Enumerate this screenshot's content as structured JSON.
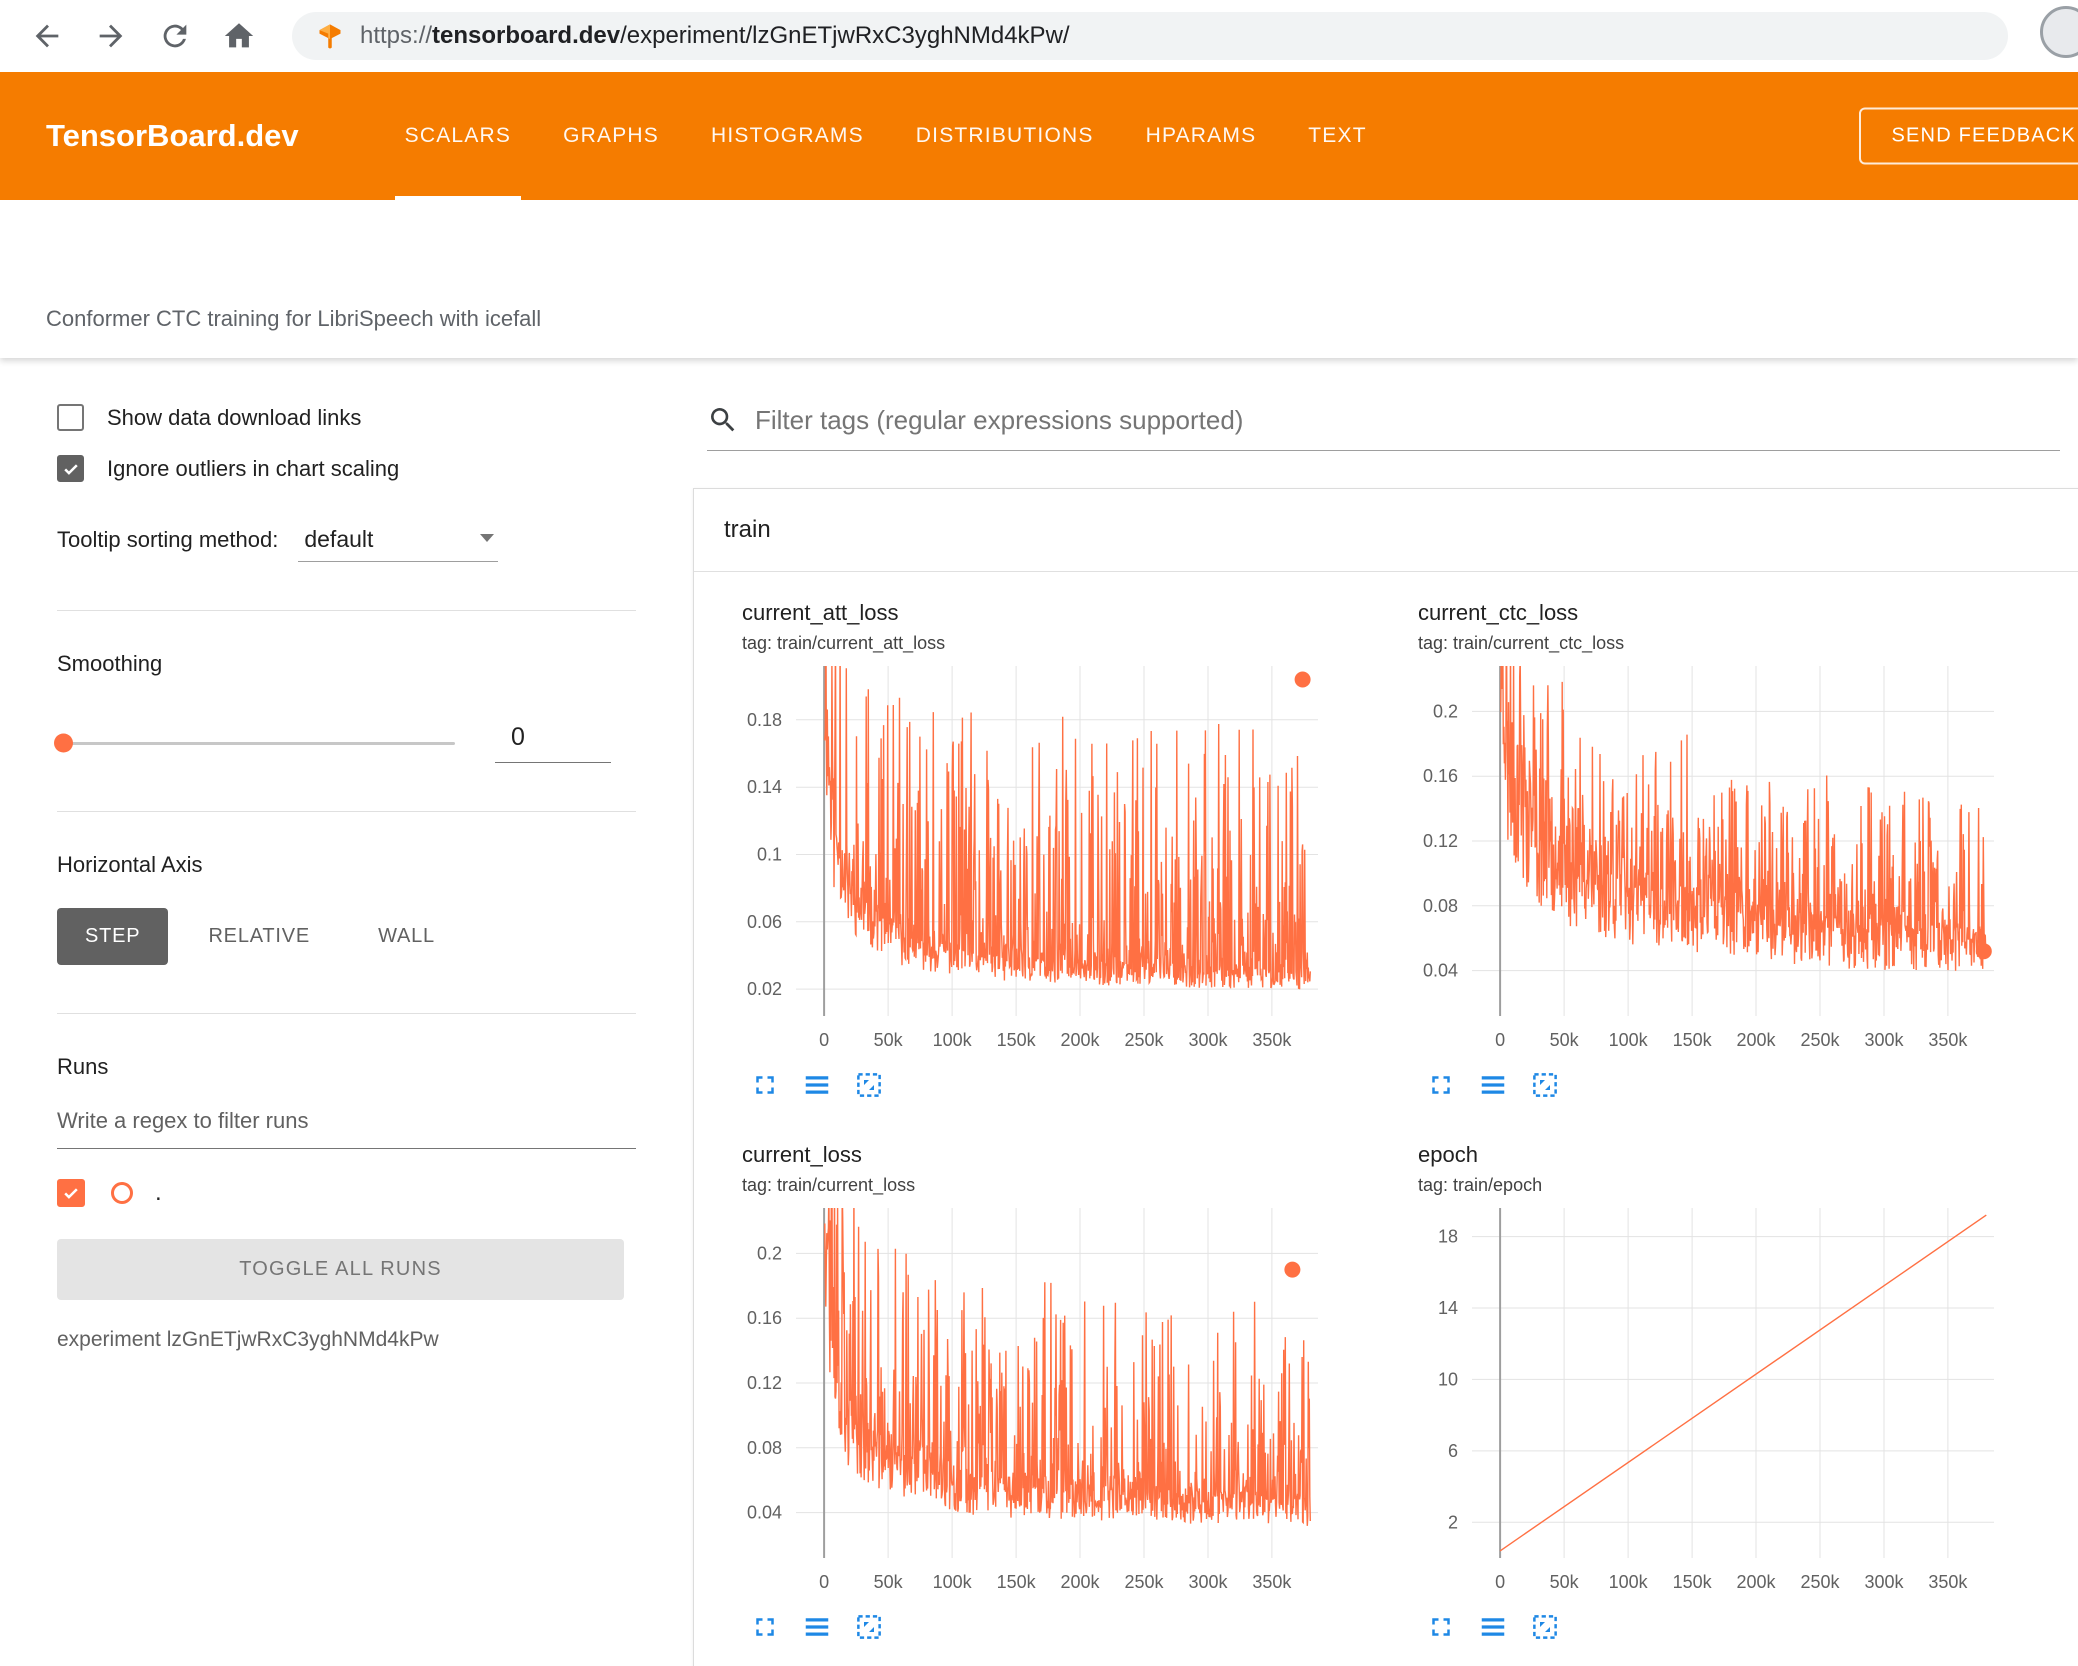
{
  "colors": {
    "header": "#f57c00",
    "series": "#ff7043",
    "tool-blue": "#1e88e5"
  },
  "browser": {
    "url_scheme": "https://",
    "url_domain": "tensorboard.dev",
    "url_path": "/experiment/lzGnETjwRxC3yghNMd4kPw/"
  },
  "header": {
    "brand": "TensorBoard.dev",
    "tabs": [
      {
        "label": "SCALARS",
        "active": true
      },
      {
        "label": "GRAPHS",
        "active": false
      },
      {
        "label": "HISTOGRAMS",
        "active": false
      },
      {
        "label": "DISTRIBUTIONS",
        "active": false
      },
      {
        "label": "HPARAMS",
        "active": false
      },
      {
        "label": "TEXT",
        "active": false
      }
    ],
    "feedback_button": "SEND FEEDBACK"
  },
  "experiment_bar": {
    "title": "Conformer CTC training for LibriSpeech with icefall"
  },
  "sidebar": {
    "show_download": {
      "label": "Show data download links",
      "checked": false
    },
    "ignore_outliers": {
      "label": "Ignore outliers in chart scaling",
      "checked": true
    },
    "tooltip_sort": {
      "label": "Tooltip sorting method:",
      "value": "default"
    },
    "smoothing": {
      "label": "Smoothing",
      "value": "0"
    },
    "horizontal_axis": {
      "label": "Horizontal Axis",
      "options": [
        {
          "label": "STEP",
          "active": true
        },
        {
          "label": "RELATIVE",
          "active": false
        },
        {
          "label": "WALL",
          "active": false
        }
      ]
    },
    "runs": {
      "label": "Runs",
      "filter_placeholder": "Write a regex to filter runs",
      "run_checked": true,
      "run_label": ".",
      "toggle_button": "TOGGLE ALL RUNS",
      "experiment_caption": "experiment lzGnETjwRxC3yghNMd4kPw"
    }
  },
  "main": {
    "filter_placeholder": "Filter tags (regular expressions supported)",
    "card_title": "train"
  },
  "icons": {
    "back-icon": "arrow-left",
    "forward-icon": "arrow-right",
    "reload-icon": "circular-arrow",
    "home-icon": "house",
    "site-favicon": "tensorboard-logo",
    "avatar": "profile-circle",
    "search-icon": "magnifier",
    "dropdown-caret-icon": "triangle-down",
    "expand-icon": "fullscreen-corners",
    "lines-icon": "three-horizontal-lines",
    "fit-domain-icon": "dashed-square-arrows"
  },
  "chart_data": [
    {
      "type": "line",
      "title": "current_att_loss",
      "tag": "tag: train/current_att_loss",
      "xlabel": "step",
      "x_range": [
        -22000,
        386000
      ],
      "y_range": [
        0.004,
        0.212
      ],
      "y_ticks": [
        0.02,
        0.06,
        0.1,
        0.14,
        0.18
      ],
      "x_tick_values": [
        0,
        50000,
        100000,
        150000,
        200000,
        250000,
        300000,
        350000
      ],
      "x_tick_labels": [
        "0",
        "50k",
        "100k",
        "150k",
        "200k",
        "250k",
        "300k",
        "350k"
      ],
      "grid": true,
      "end_dot": [
        374000,
        0.204
      ],
      "noise_spec": {
        "seed": 11,
        "n": 950,
        "x_start": 500,
        "x_end": 380000,
        "base_keys": [
          [
            0,
            0.2
          ],
          [
            6000,
            0.11
          ],
          [
            20000,
            0.07
          ],
          [
            60000,
            0.045
          ],
          [
            120000,
            0.034
          ],
          [
            240000,
            0.028
          ],
          [
            380000,
            0.026
          ]
        ],
        "spike_keys": [
          [
            0,
            0.17
          ],
          [
            30000,
            0.15
          ],
          [
            380000,
            0.145
          ]
        ],
        "spike_pow": 5,
        "wiggle": 0.5
      }
    },
    {
      "type": "line",
      "title": "current_ctc_loss",
      "tag": "tag: train/current_ctc_loss",
      "xlabel": "step",
      "x_range": [
        -22000,
        386000
      ],
      "y_range": [
        0.012,
        0.228
      ],
      "y_ticks": [
        0.04,
        0.08,
        0.12,
        0.16,
        0.2
      ],
      "x_tick_values": [
        0,
        50000,
        100000,
        150000,
        200000,
        250000,
        300000,
        350000
      ],
      "x_tick_labels": [
        "0",
        "50k",
        "100k",
        "150k",
        "200k",
        "250k",
        "300k",
        "350k"
      ],
      "grid": true,
      "end_dot": [
        378000,
        0.052
      ],
      "noise_spec": {
        "seed": 23,
        "n": 950,
        "x_start": 500,
        "x_end": 380000,
        "base_keys": [
          [
            0,
            0.24
          ],
          [
            6000,
            0.16
          ],
          [
            20000,
            0.12
          ],
          [
            60000,
            0.09
          ],
          [
            120000,
            0.074
          ],
          [
            240000,
            0.06
          ],
          [
            380000,
            0.052
          ]
        ],
        "spike_keys": [
          [
            0,
            0.11
          ],
          [
            30000,
            0.1
          ],
          [
            380000,
            0.09
          ]
        ],
        "spike_pow": 4,
        "wiggle": 0.6
      }
    },
    {
      "type": "line",
      "title": "current_loss",
      "tag": "tag: train/current_loss",
      "xlabel": "step",
      "x_range": [
        -22000,
        386000
      ],
      "y_range": [
        0.012,
        0.228
      ],
      "y_ticks": [
        0.04,
        0.08,
        0.12,
        0.16,
        0.2
      ],
      "x_tick_values": [
        0,
        50000,
        100000,
        150000,
        200000,
        250000,
        300000,
        350000
      ],
      "x_tick_labels": [
        "0",
        "50k",
        "100k",
        "150k",
        "200k",
        "250k",
        "300k",
        "350k"
      ],
      "grid": true,
      "end_dot": [
        366000,
        0.19
      ],
      "noise_spec": {
        "seed": 37,
        "n": 950,
        "x_start": 500,
        "x_end": 380000,
        "base_keys": [
          [
            0,
            0.24
          ],
          [
            6000,
            0.13
          ],
          [
            20000,
            0.085
          ],
          [
            60000,
            0.062
          ],
          [
            120000,
            0.05
          ],
          [
            240000,
            0.045
          ],
          [
            380000,
            0.042
          ]
        ],
        "spike_keys": [
          [
            0,
            0.16
          ],
          [
            30000,
            0.14
          ],
          [
            380000,
            0.13
          ]
        ],
        "spike_pow": 5,
        "wiggle": 0.5
      }
    },
    {
      "type": "line",
      "title": "epoch",
      "tag": "tag: train/epoch",
      "xlabel": "step",
      "x_range": [
        -22000,
        386000
      ],
      "y_range": [
        0,
        19.6
      ],
      "y_ticks": [
        2,
        6,
        10,
        14,
        18
      ],
      "x_tick_values": [
        0,
        50000,
        100000,
        150000,
        200000,
        250000,
        300000,
        350000
      ],
      "x_tick_labels": [
        "0",
        "50k",
        "100k",
        "150k",
        "200k",
        "250k",
        "300k",
        "350k"
      ],
      "grid": true,
      "points": [
        [
          0,
          0.4
        ],
        [
          380000,
          19.2
        ]
      ]
    }
  ]
}
